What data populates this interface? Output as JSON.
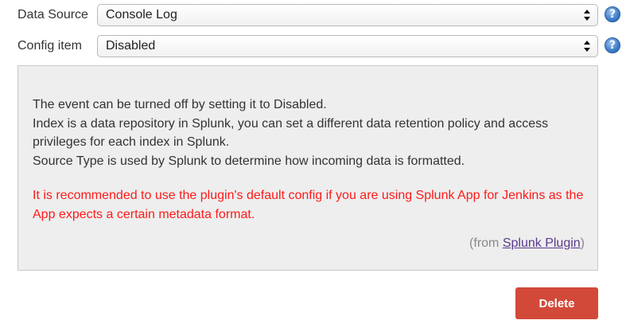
{
  "fields": [
    {
      "label": "Data Source",
      "value": "Console Log",
      "help_icon": "question-mark-icon",
      "arrows_icon": "up-down-chevron-icon"
    },
    {
      "label": "Config item",
      "value": "Disabled",
      "help_icon": "question-mark-icon",
      "arrows_icon": "up-down-chevron-icon"
    }
  ],
  "help": {
    "lines": [
      "The event can be turned off by setting it to Disabled.",
      "Index is a data repository in Splunk, you can set a different data retention policy and access privileges for each index in Splunk.",
      "Source Type is used by Splunk to determine how incoming data is formatted."
    ],
    "warning": "It is recommended to use the plugin's default config if you are using Splunk App for Jenkins as the App expects a certain metadata format.",
    "from_prefix": "(from ",
    "from_link": "Splunk Plugin",
    "from_suffix": ")"
  },
  "help_glyph": "?",
  "delete_label": "Delete",
  "colors": {
    "warning_text": "#ff1a1a",
    "delete_button": "#d24939",
    "link": "#5a3b8c",
    "help_icon": "#3b7bc9"
  }
}
